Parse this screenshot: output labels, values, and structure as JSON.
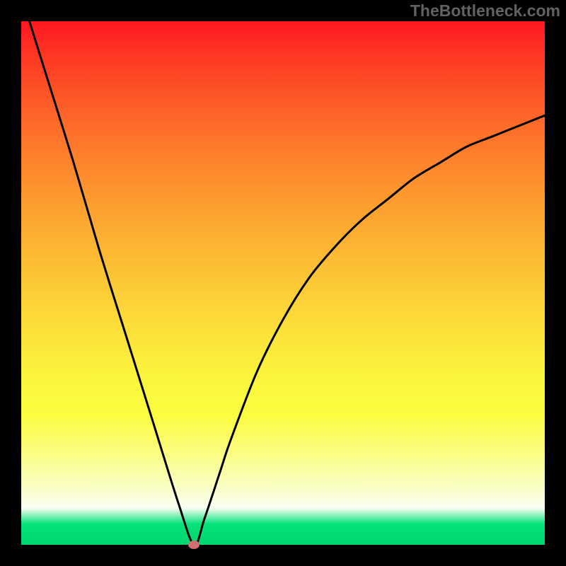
{
  "watermark": "TheBottleneck.com",
  "chart_data": {
    "type": "line",
    "title": "",
    "xlabel": "",
    "ylabel": "",
    "xlim": [
      0,
      100
    ],
    "ylim": [
      0,
      100
    ],
    "grid": false,
    "series": [
      {
        "name": "bottleneck-curve",
        "x": [
          0,
          5,
          10,
          15,
          20,
          25,
          30,
          33,
          35,
          38,
          40,
          45,
          50,
          55,
          60,
          65,
          70,
          75,
          80,
          85,
          90,
          95,
          100
        ],
        "values": [
          105,
          89,
          73,
          56,
          40,
          24,
          8,
          0,
          5,
          14,
          20,
          33,
          43,
          51,
          57,
          62,
          66,
          70,
          73,
          76,
          78,
          80,
          82
        ]
      }
    ],
    "annotations": [
      {
        "name": "minimum-marker",
        "x": 33,
        "y": 0
      }
    ],
    "background_gradient": {
      "top": "#fe1721",
      "mid": "#fcd638",
      "low": "#fafef2",
      "bottom": "#00d56e"
    }
  }
}
